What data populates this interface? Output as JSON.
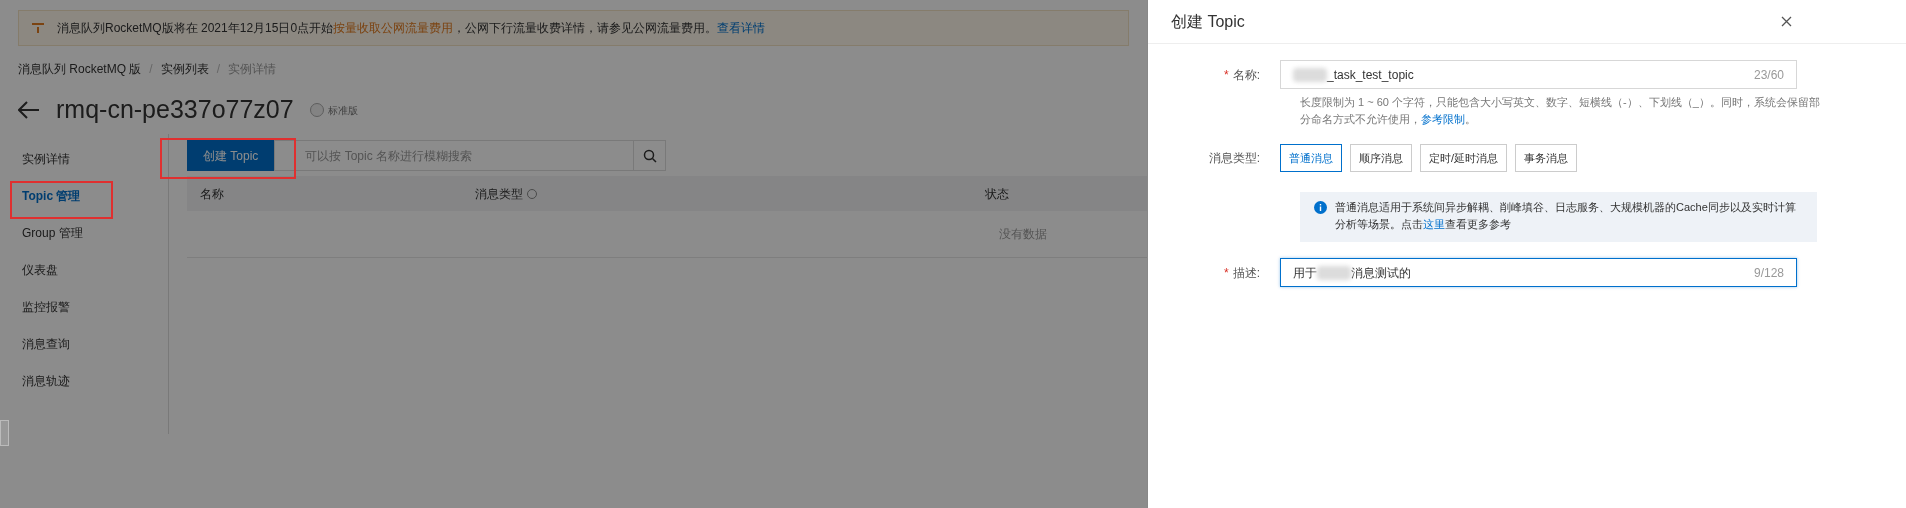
{
  "notice": {
    "segments": [
      {
        "kind": "text",
        "text": "消息队列RocketMQ版将在 2021年12月15日0点开始"
      },
      {
        "kind": "highlight",
        "text": "按量收取公网流量费用"
      },
      {
        "kind": "text",
        "text": "，公网下行流量收费详情，请参见公网流量费用。"
      },
      {
        "kind": "link",
        "text": "查看详情"
      }
    ]
  },
  "breadcrumb": {
    "separator": "/",
    "items": [
      {
        "label": "消息队列 RocketMQ 版",
        "current": false
      },
      {
        "label": "实例列表",
        "current": false
      },
      {
        "label": "实例详情",
        "current": true
      }
    ]
  },
  "instance": {
    "title": "rmq-cn-pe337o77z07",
    "badge": "标准版"
  },
  "sidebar": {
    "items": [
      {
        "label": "实例详情",
        "selected": false
      },
      {
        "label": "Topic 管理",
        "selected": true
      },
      {
        "label": "Group 管理",
        "selected": false
      },
      {
        "label": "仪表盘",
        "selected": false
      },
      {
        "label": "监控报警",
        "selected": false
      },
      {
        "label": "消息查询",
        "selected": false
      },
      {
        "label": "消息轨迹",
        "selected": false
      }
    ]
  },
  "toolbar": {
    "create_button": "创建 Topic",
    "search_placeholder": "可以按 Topic 名称进行模糊搜索"
  },
  "table": {
    "columns": [
      {
        "label": "名称",
        "help": false
      },
      {
        "label": "消息类型",
        "help": true
      },
      {
        "label": "状态",
        "help": false
      }
    ],
    "empty_text": "没有数据"
  },
  "drawer": {
    "title": "创建 Topic",
    "name_field": {
      "label": "名称:",
      "required_mark": "*",
      "segments": [
        {
          "kind": "redacted"
        },
        {
          "kind": "text",
          "text": "_task_test_topic"
        }
      ],
      "counter": "23/60",
      "focused": false
    },
    "name_help": {
      "segments": [
        {
          "kind": "text",
          "text": "长度限制为 1 ~ 60 个字符，只能包含大小写英文、数字、短横线（-）、下划线（_）。同时，系统会保留部分命名方式不允许使用，"
        },
        {
          "kind": "link",
          "text": "参考限制"
        },
        {
          "kind": "text",
          "text": "。"
        }
      ]
    },
    "message_type": {
      "label": "消息类型:",
      "options": [
        {
          "label": "普通消息",
          "selected": true
        },
        {
          "label": "顺序消息",
          "selected": false
        },
        {
          "label": "定时/延时消息",
          "selected": false
        },
        {
          "label": "事务消息",
          "selected": false
        }
      ]
    },
    "info": {
      "segments": [
        {
          "kind": "text",
          "text": "普通消息适用于系统间异步解耦、削峰填谷、日志服务、大规模机器的Cache同步以及实时计算分析等场景。点击"
        },
        {
          "kind": "link",
          "text": "这里"
        },
        {
          "kind": "text",
          "text": "查看更多参考"
        }
      ]
    },
    "description_field": {
      "label": "描述:",
      "required_mark": "*",
      "segments": [
        {
          "kind": "text",
          "text": "用于"
        },
        {
          "kind": "redacted"
        },
        {
          "kind": "text",
          "text": "消息测试的"
        }
      ],
      "counter": "9/128",
      "focused": true
    }
  }
}
